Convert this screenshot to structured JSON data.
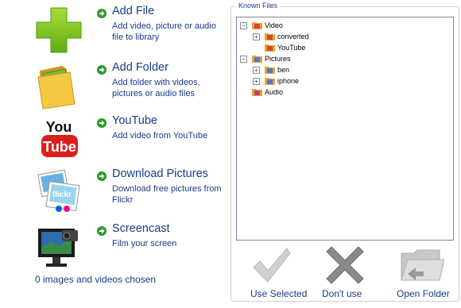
{
  "actions": [
    {
      "title": "Add File",
      "desc": "Add video, picture or audio file to library",
      "icon": "add-plus-icon"
    },
    {
      "title": "Add Folder",
      "desc": "Add folder with videos, pictures or audio files",
      "icon": "folder-icon"
    },
    {
      "title": "YouTube",
      "desc": "Add video from YouTube",
      "icon": "youtube-logo-icon"
    },
    {
      "title": "Download Pictures",
      "desc": "Download free pictures from Flickr",
      "icon": "flickr-pictures-icon"
    },
    {
      "title": "Screencast",
      "desc": "Film your screen",
      "icon": "screencast-monitor-icon"
    }
  ],
  "status": "0 images and videos chosen",
  "known_files": {
    "legend": "Known Files",
    "tree": [
      {
        "label": "Video",
        "expander": "−"
      },
      {
        "label": "converted",
        "expander": "+"
      },
      {
        "label": "YouTube",
        "expander": ""
      },
      {
        "label": "Pictures",
        "expander": "−"
      },
      {
        "label": "ben",
        "expander": "+"
      },
      {
        "label": "iphone",
        "expander": "+"
      },
      {
        "label": "Audio",
        "expander": ""
      }
    ]
  },
  "buttons": {
    "use_selected": "Use Selected",
    "dont_use": "Don't use",
    "open_folder": "Open Folder"
  },
  "colors": {
    "link_text": "#1b3a8a",
    "arrow_green": "#2a9a2a",
    "plus_green": "#7ac322"
  }
}
